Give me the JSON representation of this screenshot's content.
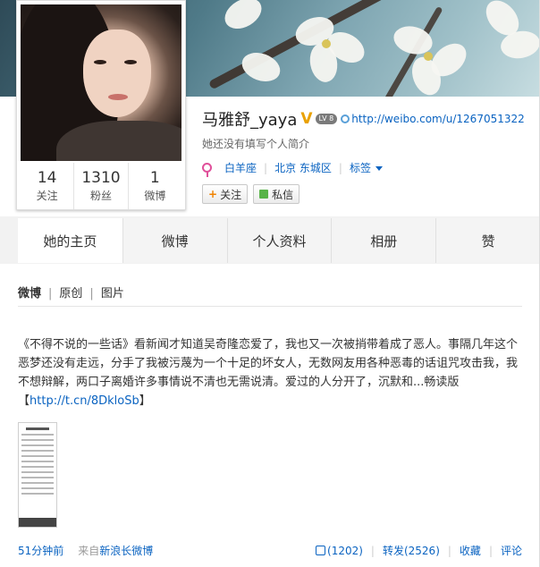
{
  "profile": {
    "name": "马雅舒_yaya",
    "vip_badge": "V",
    "level_badge": "LV 8",
    "url": "http://weibo.com/u/1267051322",
    "bio": "她还没有填写个人简介",
    "zodiac": "白羊座",
    "location": "北京 东城区",
    "tags_label": "标签",
    "follow_button": "关注",
    "follow_plus": "+",
    "message_button": "私信"
  },
  "stats": [
    {
      "num": "14",
      "label": "关注"
    },
    {
      "num": "1310",
      "label": "粉丝"
    },
    {
      "num": "1",
      "label": "微博"
    }
  ],
  "tabs": [
    "她的主页",
    "微博",
    "个人资料",
    "相册",
    "赞"
  ],
  "subnav": {
    "items": [
      "微博",
      "原创",
      "图片"
    ],
    "divider": "|"
  },
  "post": {
    "text": "《不得不说的一些话》看新闻才知道吴奇隆恋爱了，我也又一次被捎带着成了恶人。事隔几年这个恶梦还没有走远，分手了我被污蔑为一个十足的坏女人，无数网友用各种恶毒的话诅咒攻击我，我不想辩解，两口子离婚许多事情说不清也无需说清。爱过的人分开了，沉默和...畅读版【",
    "link": "http://t.cn/8DkloSb",
    "link_close": "】",
    "time": "51分钟前",
    "from_prefix": "来自",
    "from_source": "新浪长微博",
    "likes": "(1202)",
    "repost": "转发(2526)",
    "favorite": "收藏",
    "comment": "评论",
    "separator": "|"
  },
  "colors": {
    "link": "#0a63c1",
    "vip": "#e9a100",
    "accent_follow": "#f08200",
    "message_icon": "#58b348"
  }
}
